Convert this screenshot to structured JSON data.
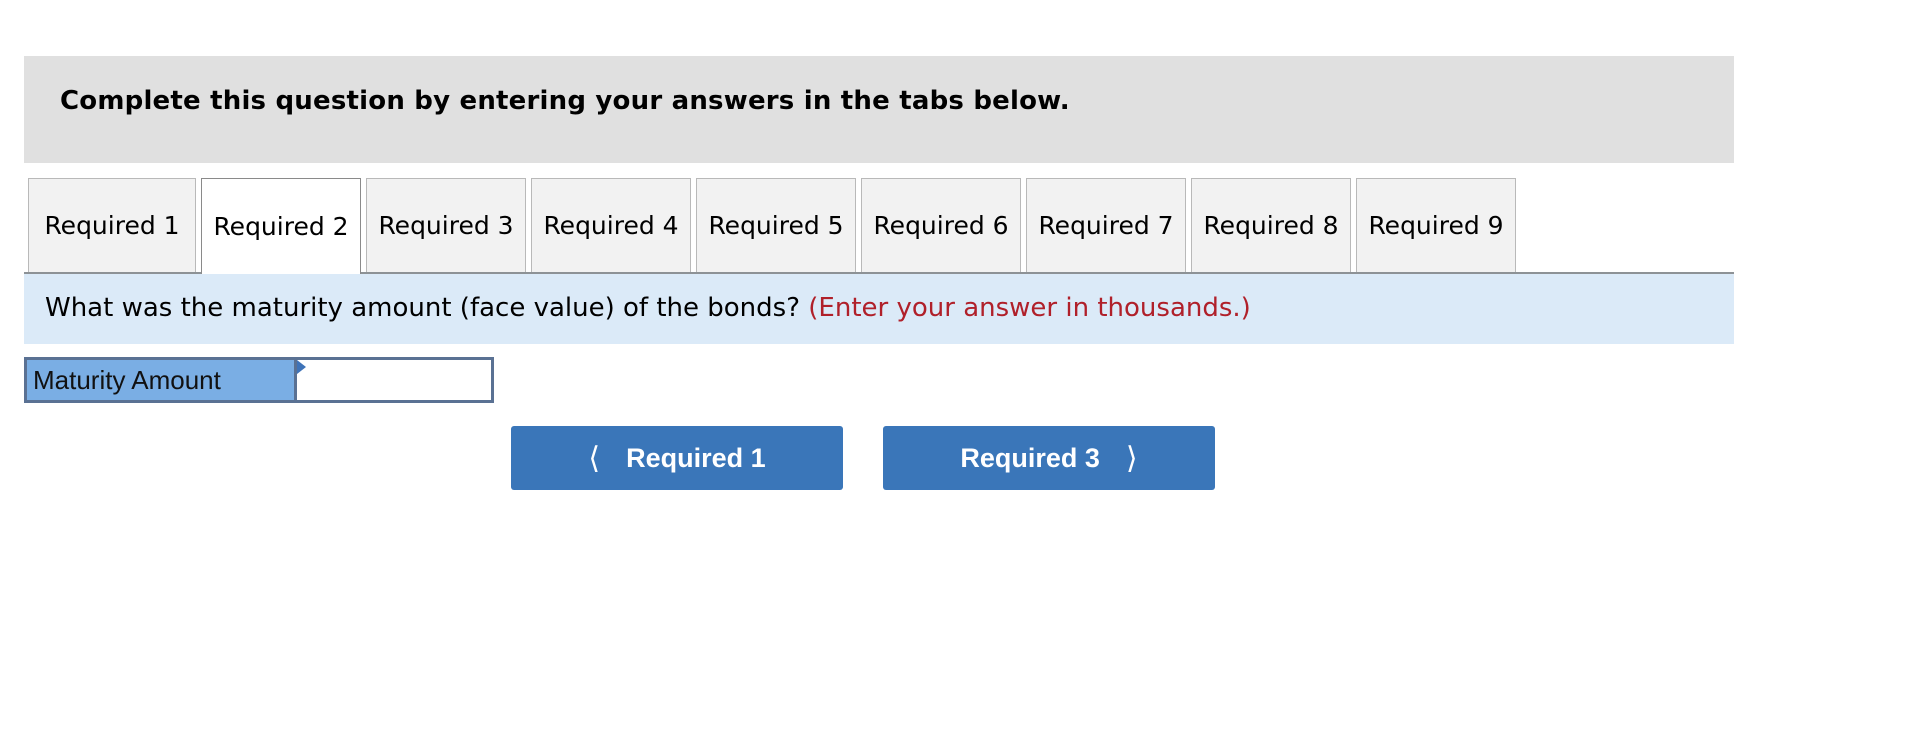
{
  "header": {
    "instruction": "Complete this question by entering your answers in the tabs below."
  },
  "tabs": [
    {
      "label": "Required 1",
      "active": false
    },
    {
      "label": "Required 2",
      "active": true
    },
    {
      "label": "Required 3",
      "active": false
    },
    {
      "label": "Required 4",
      "active": false
    },
    {
      "label": "Required 5",
      "active": false
    },
    {
      "label": "Required 6",
      "active": false
    },
    {
      "label": "Required 7",
      "active": false
    },
    {
      "label": "Required 8",
      "active": false
    },
    {
      "label": "Required 9",
      "active": false
    }
  ],
  "question": {
    "text": "What was the maturity amount (face value) of the bonds?",
    "note": "(Enter your answer in thousands.)"
  },
  "answer_row": {
    "label": "Maturity Amount",
    "value": ""
  },
  "nav": {
    "prev_label": "Required 1",
    "next_label": "Required 3",
    "prev_icon": "chevron-left-icon",
    "next_icon": "chevron-right-icon"
  },
  "colors": {
    "button": "#3a76b9",
    "label_cell": "#7aaee4",
    "question_bg": "#dbeaf8",
    "note": "#b0202a",
    "header_bg": "#e0e0e0"
  }
}
